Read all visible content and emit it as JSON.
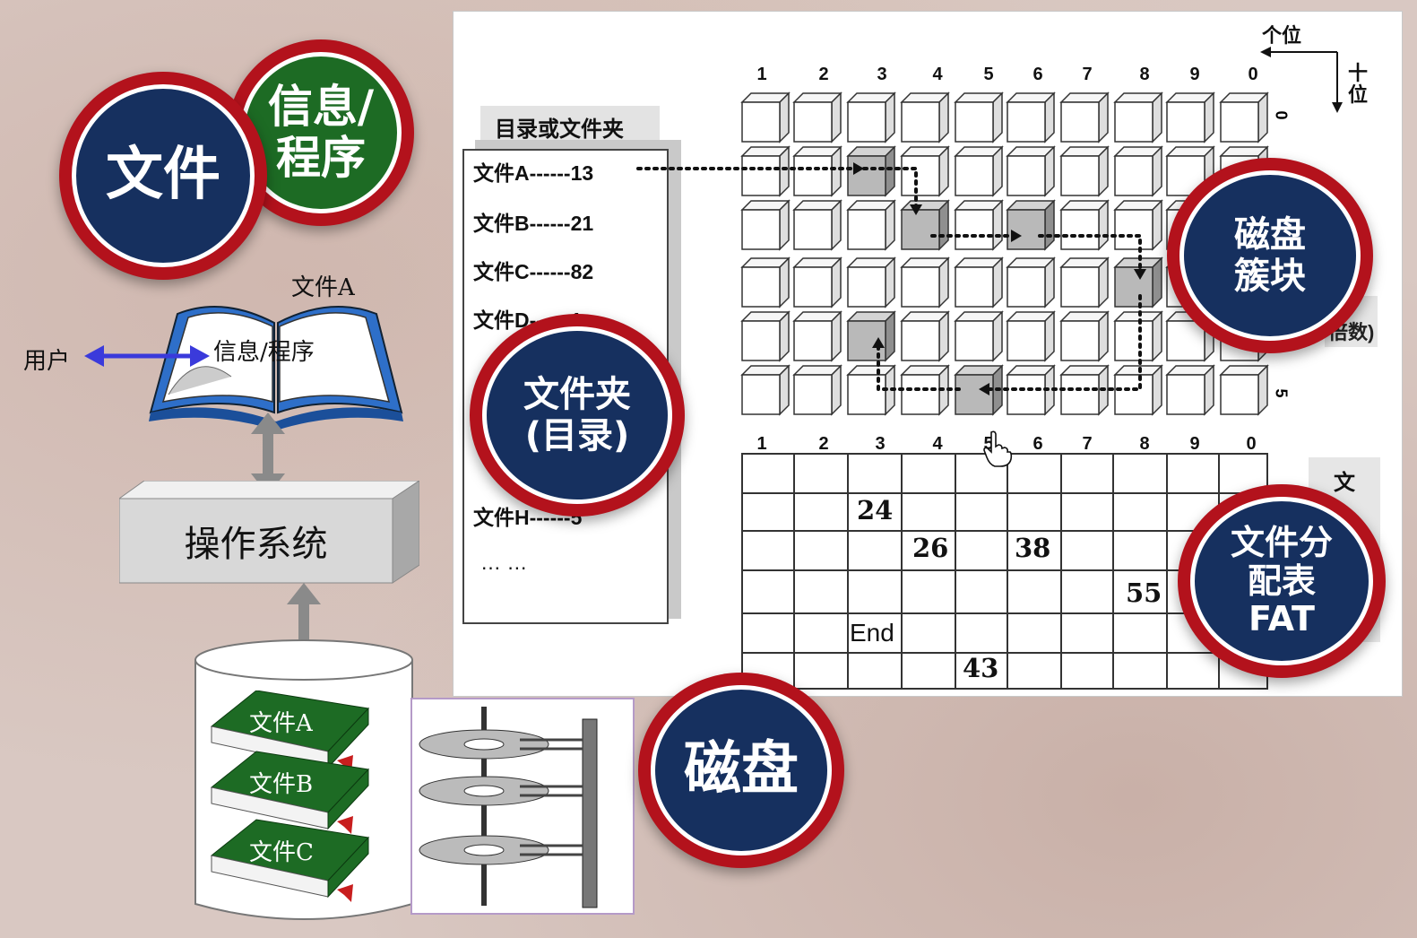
{
  "badges": {
    "file": "文件",
    "info": "信息/\n程序",
    "folder": "文件夹\n(目录)",
    "cluster": "磁盘\n簇块",
    "fat": "文件分\n配表\nFAT",
    "disk": "磁盘"
  },
  "left": {
    "book_label": "文件A",
    "book_content": "信息/程序",
    "user_label": "用户",
    "os_label": "操作系统",
    "db_books": [
      "文件A",
      "文件B",
      "文件C"
    ]
  },
  "directory": {
    "title": "目录或文件夹",
    "entries": [
      "文件A------13",
      "文件B------21",
      "文件C------82",
      "文件D------1",
      "文件H------5"
    ],
    "ellipsis": "… …"
  },
  "grid": {
    "col_numbers": [
      "1",
      "2",
      "3",
      "4",
      "5",
      "6",
      "7",
      "8",
      "9",
      "0"
    ],
    "ones_label": "个位",
    "tens_label": "十\n位",
    "row_labels": [
      "0",
      "5"
    ],
    "right_partial_text": "的\n倍数)",
    "highlighted_cells": [
      [
        1,
        2
      ],
      [
        2,
        3
      ],
      [
        2,
        5
      ],
      [
        3,
        7
      ],
      [
        4,
        2
      ],
      [
        5,
        4
      ]
    ]
  },
  "fat": {
    "col_numbers": [
      "1",
      "2",
      "3",
      "4",
      "5",
      "6",
      "7",
      "8",
      "9",
      "0"
    ],
    "row_labels": [
      "0",
      "5"
    ],
    "values": [
      {
        "row": 1,
        "col": 2,
        "text": "24"
      },
      {
        "row": 2,
        "col": 3,
        "text": "26"
      },
      {
        "row": 2,
        "col": 5,
        "text": "38"
      },
      {
        "row": 3,
        "col": 7,
        "text": "55"
      },
      {
        "row": 4,
        "col": 2,
        "text": "End"
      },
      {
        "row": 5,
        "col": 4,
        "text": "43"
      }
    ],
    "side_text": "文"
  },
  "colors": {
    "badge_ring": "#b3121c",
    "badge_navy": "#16305f",
    "badge_green": "#1d6b24",
    "book_green": "#1d6b24",
    "arrow_blue": "#3a3adb"
  }
}
